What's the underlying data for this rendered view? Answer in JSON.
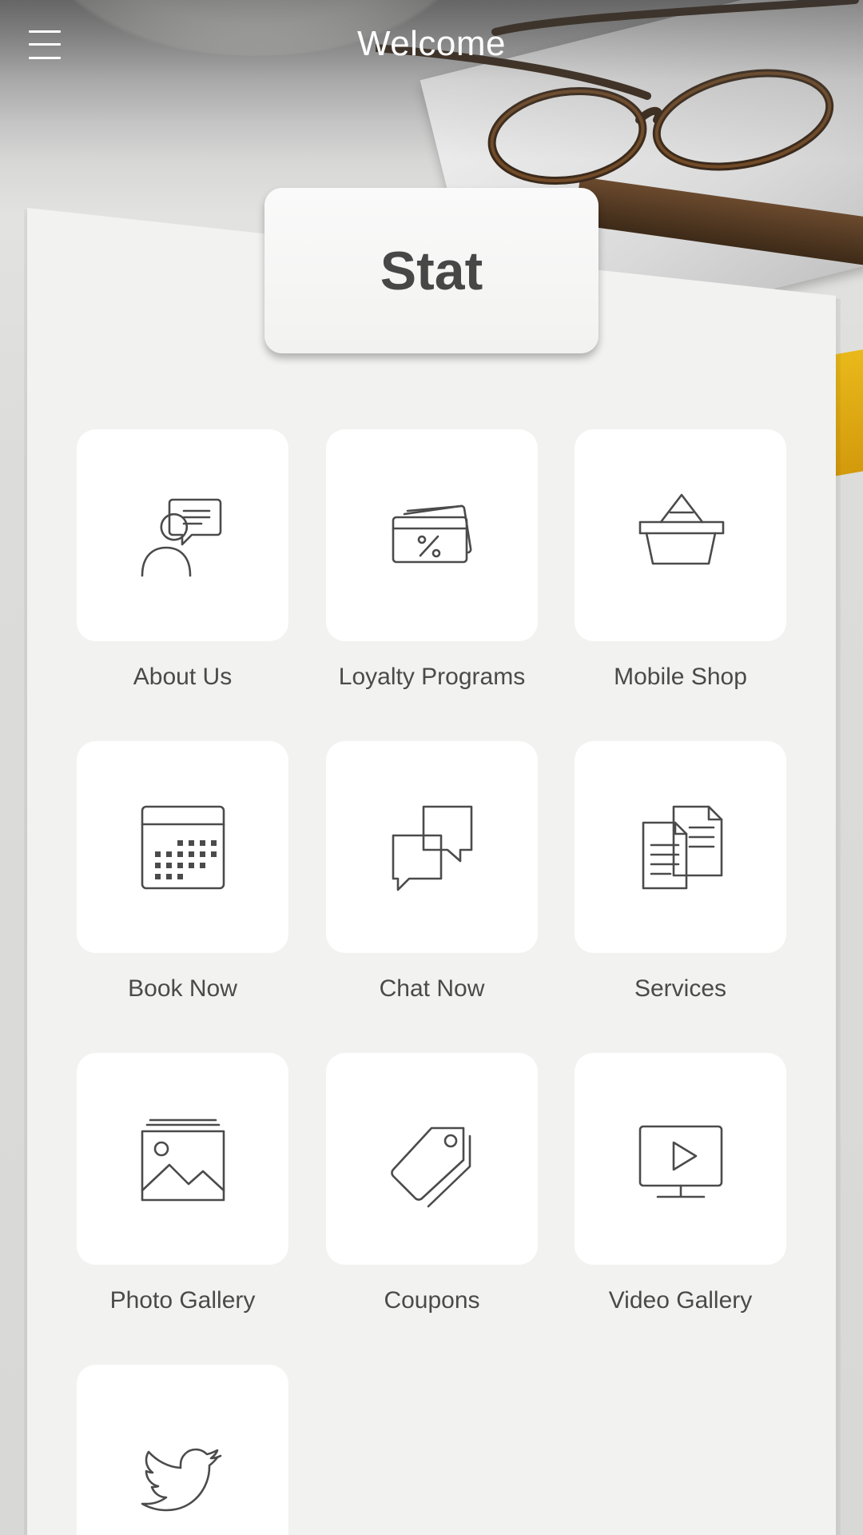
{
  "header": {
    "title": "Welcome",
    "menu_icon": "hamburger-menu-icon"
  },
  "brand": {
    "name": "Stat"
  },
  "tiles": [
    {
      "label": "About Us",
      "icon": "person-chat-icon"
    },
    {
      "label": "Loyalty Programs",
      "icon": "loyalty-card-icon"
    },
    {
      "label": "Mobile Shop",
      "icon": "shopping-basket-icon"
    },
    {
      "label": "Book Now",
      "icon": "calendar-icon"
    },
    {
      "label": "Chat Now",
      "icon": "chat-bubbles-icon"
    },
    {
      "label": "Services",
      "icon": "documents-icon"
    },
    {
      "label": "Photo Gallery",
      "icon": "photo-gallery-icon"
    },
    {
      "label": "Coupons",
      "icon": "coupon-tags-icon"
    },
    {
      "label": "Video Gallery",
      "icon": "video-screen-icon"
    },
    {
      "label": "",
      "icon": "twitter-bird-icon"
    }
  ],
  "colors": {
    "panel": "#f2f2f0",
    "tile": "#ffffff",
    "text": "#4a4a4a",
    "icon_stroke": "#4b4b4b",
    "header_text": "#ffffff"
  }
}
